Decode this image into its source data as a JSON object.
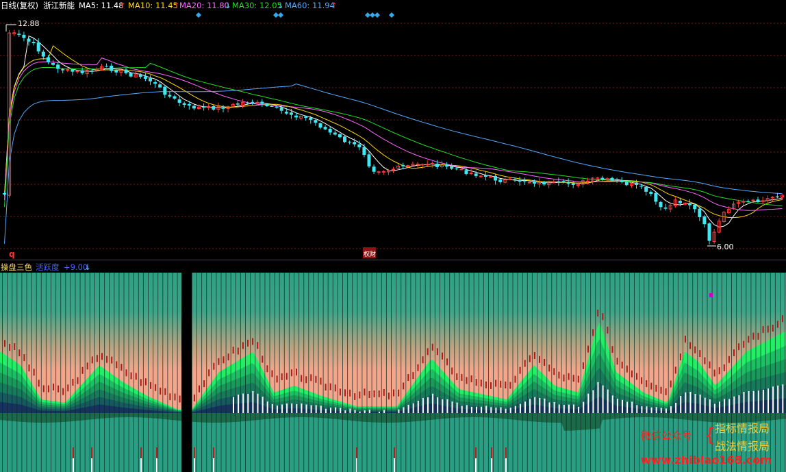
{
  "header": {
    "period_label": "日线(复权)",
    "stock_name": "浙江新能",
    "ma": [
      {
        "label": "MA5: 11.48",
        "arrow": "↑",
        "color": "#ffffff"
      },
      {
        "label": "MA10: 11.45",
        "arrow": "↑",
        "color": "#ffd700"
      },
      {
        "label": "MA20: 11.80",
        "arrow": "↓",
        "color": "#ff66ff"
      },
      {
        "label": "MA30: 12.05",
        "arrow": "↓",
        "color": "#22dd22"
      },
      {
        "label": "MA60: 11.94",
        "arrow": "↑",
        "color": "#55aaff"
      }
    ],
    "arrow_up_color": "#ff3333",
    "arrow_down_color": "#55ccff"
  },
  "main_chart": {
    "high_label": "12.88",
    "low_label": "6.00",
    "event_marker": "q",
    "event_badge": "权财",
    "colors": {
      "up": "#ff3c3c",
      "down": "#3fe7f2",
      "ma5": "#ffffff",
      "ma10": "#ffd700",
      "ma20": "#ff66ff",
      "ma30": "#22dd22",
      "ma60": "#55aaff",
      "grid": "#7a1a1a",
      "diamond": "#33aaee"
    }
  },
  "sub_chart": {
    "title": "操盘三色",
    "label2": "活跃度",
    "value_label": "+9.00",
    "value_arrow": "↓",
    "colors": {
      "teal": "#2a9e82",
      "salmon": "#f2a48a",
      "green_bright": "#22ee66",
      "green_mid": "#1aa057",
      "blue_dark": "#15335e",
      "dark_red": "#b01a1a",
      "magenta": "#cc00cc"
    }
  },
  "watermark": {
    "line1_left": "微信公众号",
    "line1_right": "指标情报局",
    "line2": "战法情报局",
    "url": "www.zhibiao168.com"
  }
}
